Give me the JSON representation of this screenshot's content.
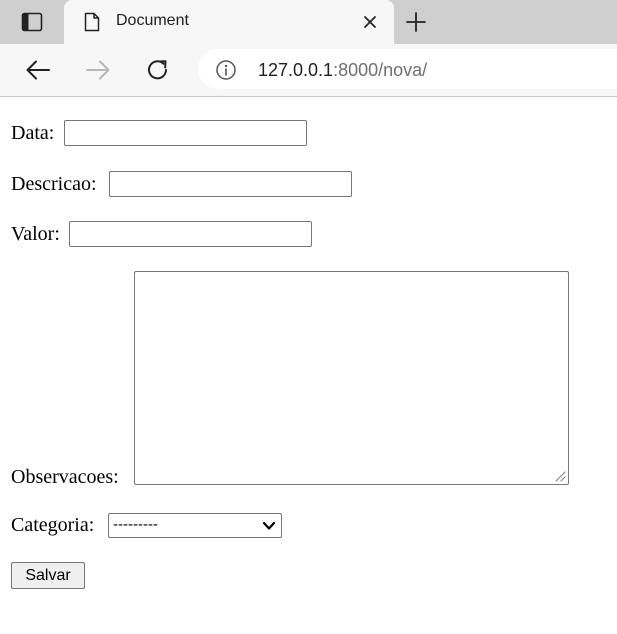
{
  "browser": {
    "tab": {
      "title": "Document"
    },
    "address": {
      "host": "127.0.0.1",
      "rest": ":8000/nova/"
    }
  },
  "icons": {
    "tab_actions": "tab-actions-icon",
    "favicon": "document-icon",
    "close": "close-icon",
    "new_tab": "plus-icon",
    "back": "arrow-left-icon",
    "forward": "arrow-right-icon",
    "reload": "reload-icon",
    "site_info": "info-icon",
    "dropdown": "chevron-down-icon"
  },
  "form": {
    "data_label": "Data:",
    "data_value": "",
    "descricao_label": "Descricao:",
    "descricao_value": "",
    "valor_label": "Valor:",
    "valor_value": "",
    "observacoes_label": "Observacoes:",
    "observacoes_value": "",
    "categoria_label": "Categoria:",
    "categoria_selected": "---------",
    "submit_label": "Salvar"
  }
}
